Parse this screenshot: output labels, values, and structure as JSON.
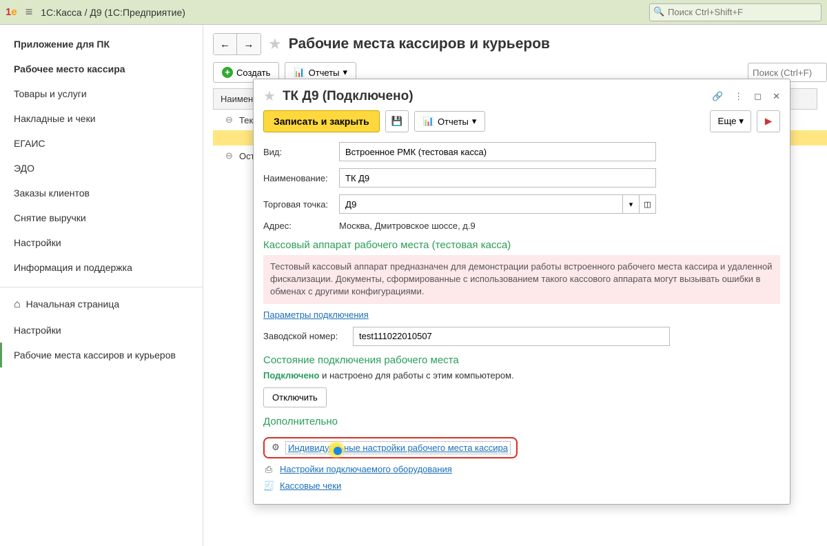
{
  "header": {
    "title": "1С:Касса / Д9  (1С:Предприятие)",
    "search_placeholder": "Поиск Ctrl+Shift+F"
  },
  "sidebar": {
    "items": [
      {
        "label": "Приложение для ПК",
        "bold": true
      },
      {
        "label": "Рабочее место кассира",
        "bold": true
      },
      {
        "label": "Товары и услуги"
      },
      {
        "label": "Накладные и чеки"
      },
      {
        "label": "ЕГАИС"
      },
      {
        "label": "ЭДО"
      },
      {
        "label": "Заказы клиентов"
      },
      {
        "label": "Снятие выручки"
      },
      {
        "label": "Настройки"
      },
      {
        "label": "Информация и поддержка"
      }
    ],
    "section2": [
      {
        "label": "Начальная страница",
        "home": true
      },
      {
        "label": "Настройки"
      },
      {
        "label": "Рабочие места кассиров и курьеров",
        "selected": true
      }
    ]
  },
  "page": {
    "title": "Рабочие места кассиров и курьеров",
    "create": "Создать",
    "reports": "Отчеты",
    "search_placeholder": "Поиск (Ctrl+F)",
    "col_name": "Наимено",
    "rows": [
      {
        "label": "Текущ",
        "toggle": "⊖"
      },
      {
        "label": "",
        "toggle": "",
        "dotGreen": true,
        "selected": true
      },
      {
        "label": "Остал",
        "toggle": "⊖"
      },
      {
        "label": "",
        "toggle": "",
        "dotAmber": true
      }
    ]
  },
  "dialog": {
    "title": "ТК Д9 (Подключено)",
    "save_close": "Записать и закрыть",
    "reports": "Отчеты",
    "more": "Еще",
    "fields": {
      "type_label": "Вид:",
      "type_value": "Встроенное РМК (тестовая касса)",
      "name_label": "Наименование:",
      "name_value": "ТК Д9",
      "point_label": "Торговая точка:",
      "point_value": "Д9",
      "addr_label": "Адрес:",
      "addr_value": "Москва, Дмитровское шоссе, д.9"
    },
    "section1_title": "Кассовый аппарат рабочего места (тестовая касса)",
    "warning": "Тестовый кассовый аппарат предназначен для демонстрации работы встроенного рабочего места кассира и удаленной фискализации. Документы, сформированные с использованием такого кассового аппарата могут вызывать ошибки в обменах с другими конфигурациями.",
    "conn_params": "Параметры подключения",
    "serial_label": "Заводской номер:",
    "serial_value": "test111022010507",
    "section2_title": "Состояние подключения рабочего места",
    "status_ok": "Подключено",
    "status_rest": " и настроено для работы с этим компьютером.",
    "disconnect": "Отключить",
    "section3_title": "Дополнительно",
    "link1": "Индивидуальные настройки рабочего места кассира",
    "link2": "Настройки подключаемого оборудования",
    "link3": "Кассовые чеки"
  }
}
